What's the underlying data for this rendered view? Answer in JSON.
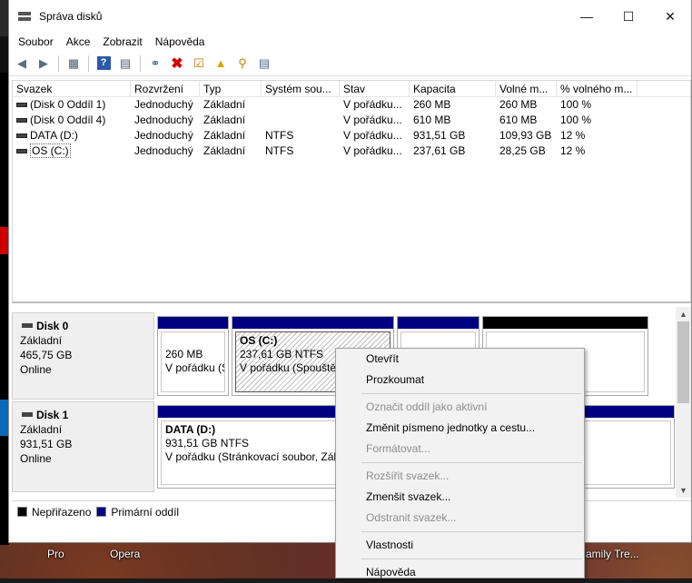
{
  "window": {
    "title": "Správa disků"
  },
  "menu": [
    "Soubor",
    "Akce",
    "Zobrazit",
    "Nápověda"
  ],
  "toolbar": {
    "icons": [
      "back-arrow-icon",
      "forward-arrow-icon",
      "console-tree-icon",
      "help-icon",
      "properties-icon",
      "connect-icon",
      "delete-icon",
      "check-icon",
      "import-icon",
      "search-icon",
      "view-icon"
    ]
  },
  "volume_list": {
    "columns": [
      "Svazek",
      "Rozvržení",
      "Typ",
      "Systém sou...",
      "Stav",
      "Kapacita",
      "Volné m...",
      "% volného m..."
    ],
    "rows": [
      [
        "(Disk 0 Oddíl 1)",
        "Jednoduchý",
        "Základní",
        "",
        "V pořádku...",
        "260 MB",
        "260 MB",
        "100 %"
      ],
      [
        "(Disk 0 Oddíl 4)",
        "Jednoduchý",
        "Základní",
        "",
        "V pořádku...",
        "610 MB",
        "610 MB",
        "100 %"
      ],
      [
        "DATA (D:)",
        "Jednoduchý",
        "Základní",
        "NTFS",
        "V pořádku...",
        "931,51 GB",
        "109,93 GB",
        "12 %"
      ],
      [
        "OS (C:)",
        "Jednoduchý",
        "Základní",
        "NTFS",
        "V pořádku...",
        "237,61 GB",
        "28,25 GB",
        "12 %"
      ]
    ]
  },
  "disks": [
    {
      "name": "Disk 0",
      "type": "Základní",
      "size": "465,75 GB",
      "status": "Online",
      "partitions": [
        {
          "line1": "",
          "line2": "260 MB",
          "line3": "V pořádku (S"
        },
        {
          "line1": "OS  (C:)",
          "line2": "237,61 GB NTFS",
          "line3": "V pořádku (Spouštěc"
        },
        {
          "line1": "",
          "line2": "",
          "line3": ""
        },
        {
          "line1": "",
          "line2": "",
          "line3": ""
        }
      ]
    },
    {
      "name": "Disk 1",
      "type": "Základní",
      "size": "931,51 GB",
      "status": "Online",
      "partitions": [
        {
          "line1": "DATA  (D:)",
          "line2": "931,51 GB NTFS",
          "line3": "V pořádku (Stránkovací soubor, Zákl"
        }
      ]
    }
  ],
  "legend": {
    "unallocated": "Nepřiřazeno",
    "primary": "Primární oddíl",
    "colors": {
      "unallocated": "#000000",
      "primary": "#000080"
    }
  },
  "context_menu": {
    "items": [
      {
        "label": "Otevřít",
        "enabled": true
      },
      {
        "label": "Prozkoumat",
        "enabled": true
      },
      {
        "label": "Označit oddíl jako aktivní",
        "enabled": false
      },
      {
        "label": "Změnit písmeno jednotky a cestu...",
        "enabled": true
      },
      {
        "label": "Formátovat...",
        "enabled": false
      },
      {
        "label": "Rozšířit svazek...",
        "enabled": false
      },
      {
        "label": "Zmenšit svazek...",
        "enabled": true
      },
      {
        "label": "Odstranit svazek...",
        "enabled": false
      },
      {
        "label": "Vlastnosti",
        "enabled": true
      },
      {
        "label": "Nápověda",
        "enabled": true
      }
    ]
  },
  "desktop": {
    "icon_labels": [
      "Pro",
      "Opera",
      "amily Tre..."
    ]
  }
}
